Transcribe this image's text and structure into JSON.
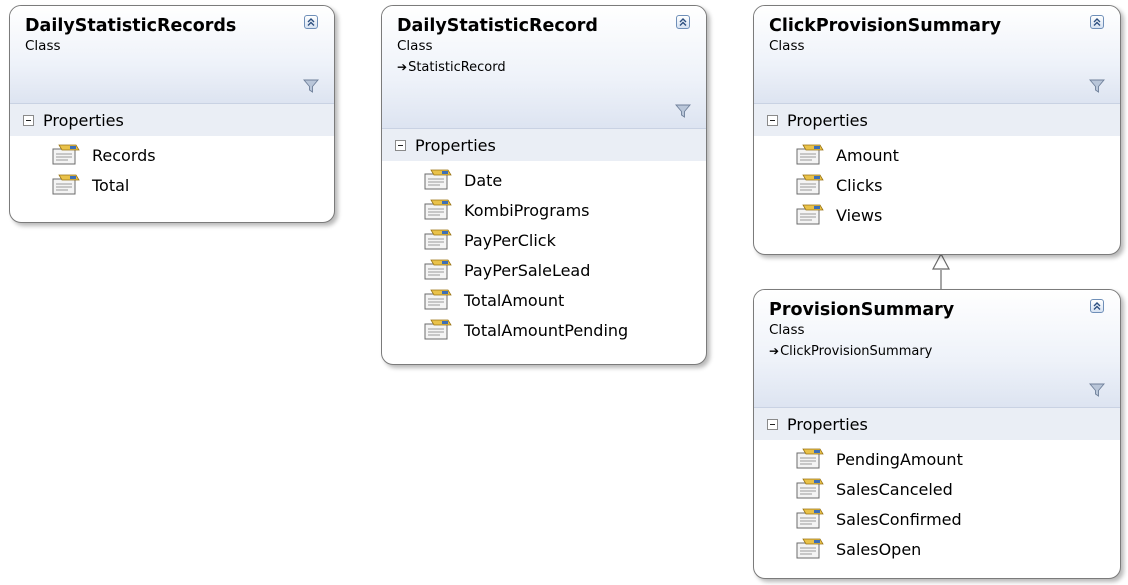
{
  "diagram": {
    "classes": [
      {
        "id": "daily-statistic-records",
        "name": "DailyStatisticRecords",
        "kind": "Class",
        "base": "",
        "section_label": "Properties",
        "properties": [
          "Records",
          "Total"
        ]
      },
      {
        "id": "daily-statistic-record",
        "name": "DailyStatisticRecord",
        "kind": "Class",
        "base": "StatisticRecord",
        "section_label": "Properties",
        "properties": [
          "Date",
          "KombiPrograms",
          "PayPerClick",
          "PayPerSaleLead",
          "TotalAmount",
          "TotalAmountPending"
        ]
      },
      {
        "id": "click-provision-summary",
        "name": "ClickProvisionSummary",
        "kind": "Class",
        "base": "",
        "section_label": "Properties",
        "properties": [
          "Amount",
          "Clicks",
          "Views"
        ]
      },
      {
        "id": "provision-summary",
        "name": "ProvisionSummary",
        "kind": "Class",
        "base": "ClickProvisionSummary",
        "section_label": "Properties",
        "properties": [
          "PendingAmount",
          "SalesCanceled",
          "SalesConfirmed",
          "SalesOpen"
        ]
      }
    ],
    "relations": [
      {
        "type": "inheritance",
        "from": "ProvisionSummary",
        "to": "ClickProvisionSummary"
      }
    ]
  },
  "icons": {
    "collapse": "double-chevron-up-icon",
    "filter": "filter-icon",
    "section_expander": "minus-box-icon",
    "property": "property-icon",
    "base_arrow": "inheritance-arrow-icon"
  },
  "colors": {
    "header_gradient_top": "#ffffff",
    "header_gradient_bottom": "#dde4f1",
    "section_background": "#eaeef5",
    "border": "#7b7b7b",
    "button_blue": "#6f8fb8"
  }
}
